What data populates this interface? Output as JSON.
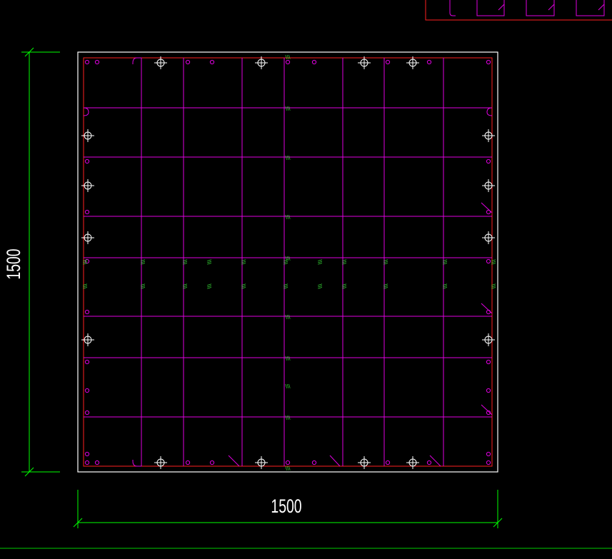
{
  "drawing": {
    "dimension_horizontal": "1500",
    "dimension_vertical": "1500",
    "bar_label": "\\\\\\"
  },
  "colors": {
    "background": "#000000",
    "outline": "#ffffff",
    "cover_line": "#ff2020",
    "rebar": "#e000e0",
    "dimension": "#00ff00",
    "label": "#40ff40",
    "marker": "#ffffff"
  }
}
